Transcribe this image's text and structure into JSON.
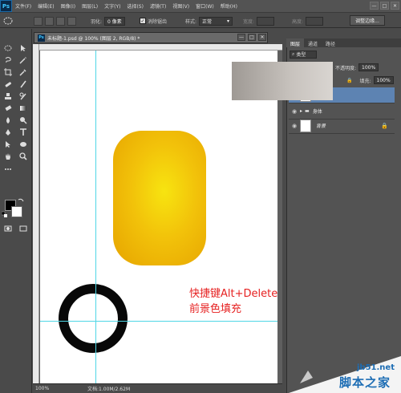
{
  "app": {
    "logo": "Ps",
    "menu": [
      "文件(F)",
      "编辑(E)",
      "图像(I)",
      "图层(L)",
      "文字(Y)",
      "选择(S)",
      "滤镜(T)",
      "视图(V)",
      "窗口(W)",
      "帮助(H)"
    ],
    "window_controls": [
      "—",
      "□",
      "✕"
    ]
  },
  "options": {
    "feather_label": "羽化:",
    "feather_value": "0 像素",
    "antialias_label": "消除锯齿",
    "style_label": "样式:",
    "style_value": "正常",
    "width_label": "宽度:",
    "height_label": "高度:",
    "refine_edge": "调整边缘..."
  },
  "document": {
    "tab_title": "未标题-1.psd @ 100% (图层 2, RGB/8) *",
    "zoom": "100%",
    "doc_info": "文档:1.00M/2.62M",
    "note_line1": "快捷键Alt+Delete键,",
    "note_line2": "前景色填充"
  },
  "panels": {
    "tabs": [
      "图层",
      "通道",
      "路径"
    ],
    "filter_label": "类型",
    "opacity_label": "不透明度:",
    "opacity_value": "100%",
    "fill_label": "填充:",
    "fill_value": "100%",
    "layers": [
      {
        "name": "",
        "selected": true
      },
      {
        "name": "身体",
        "selected": false,
        "group": true
      },
      {
        "name": "背景",
        "selected": false,
        "locked": true
      }
    ]
  },
  "watermark": {
    "url": "jb51.net",
    "name": "脚本之家"
  },
  "colors": {
    "foreground": "#000000",
    "background": "#ffffff",
    "note": "#e62020",
    "guide": "#4fd7e6"
  }
}
